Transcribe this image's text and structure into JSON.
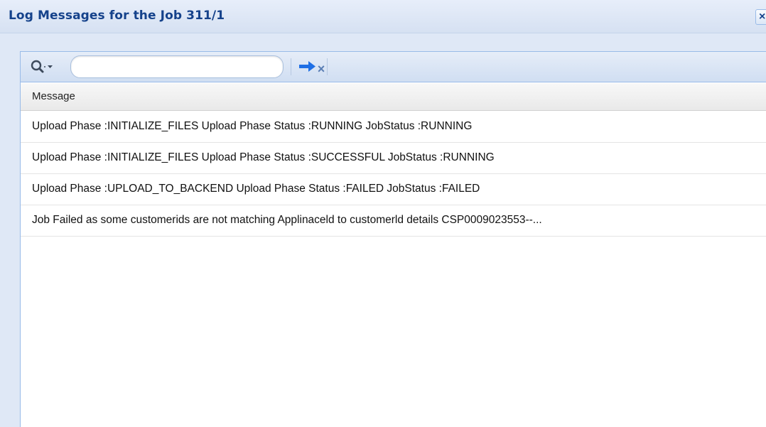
{
  "window": {
    "title": "Log Messages for the Job 311/1",
    "close_glyph": "×"
  },
  "toolbar": {
    "search_icon": "search-icon",
    "search_placeholder": "",
    "search_value": "",
    "clear_glyph": "×",
    "go_icon": "arrow-right-icon"
  },
  "grid": {
    "column_header": "Message",
    "rows": [
      "Upload Phase :INITIALIZE_FILES Upload Phase Status :RUNNING JobStatus :RUNNING",
      "Upload Phase :INITIALIZE_FILES Upload Phase Status :SUCCESSFUL JobStatus :RUNNING",
      "Upload Phase :UPLOAD_TO_BACKEND Upload Phase Status :FAILED JobStatus :FAILED",
      "Job Failed as some customerids are not matching Applinaceld to customerld details CSP0009023553--..."
    ]
  },
  "colors": {
    "title_text": "#15428b",
    "accent_blue": "#1f6fe5",
    "panel_border": "#99bbe8"
  }
}
